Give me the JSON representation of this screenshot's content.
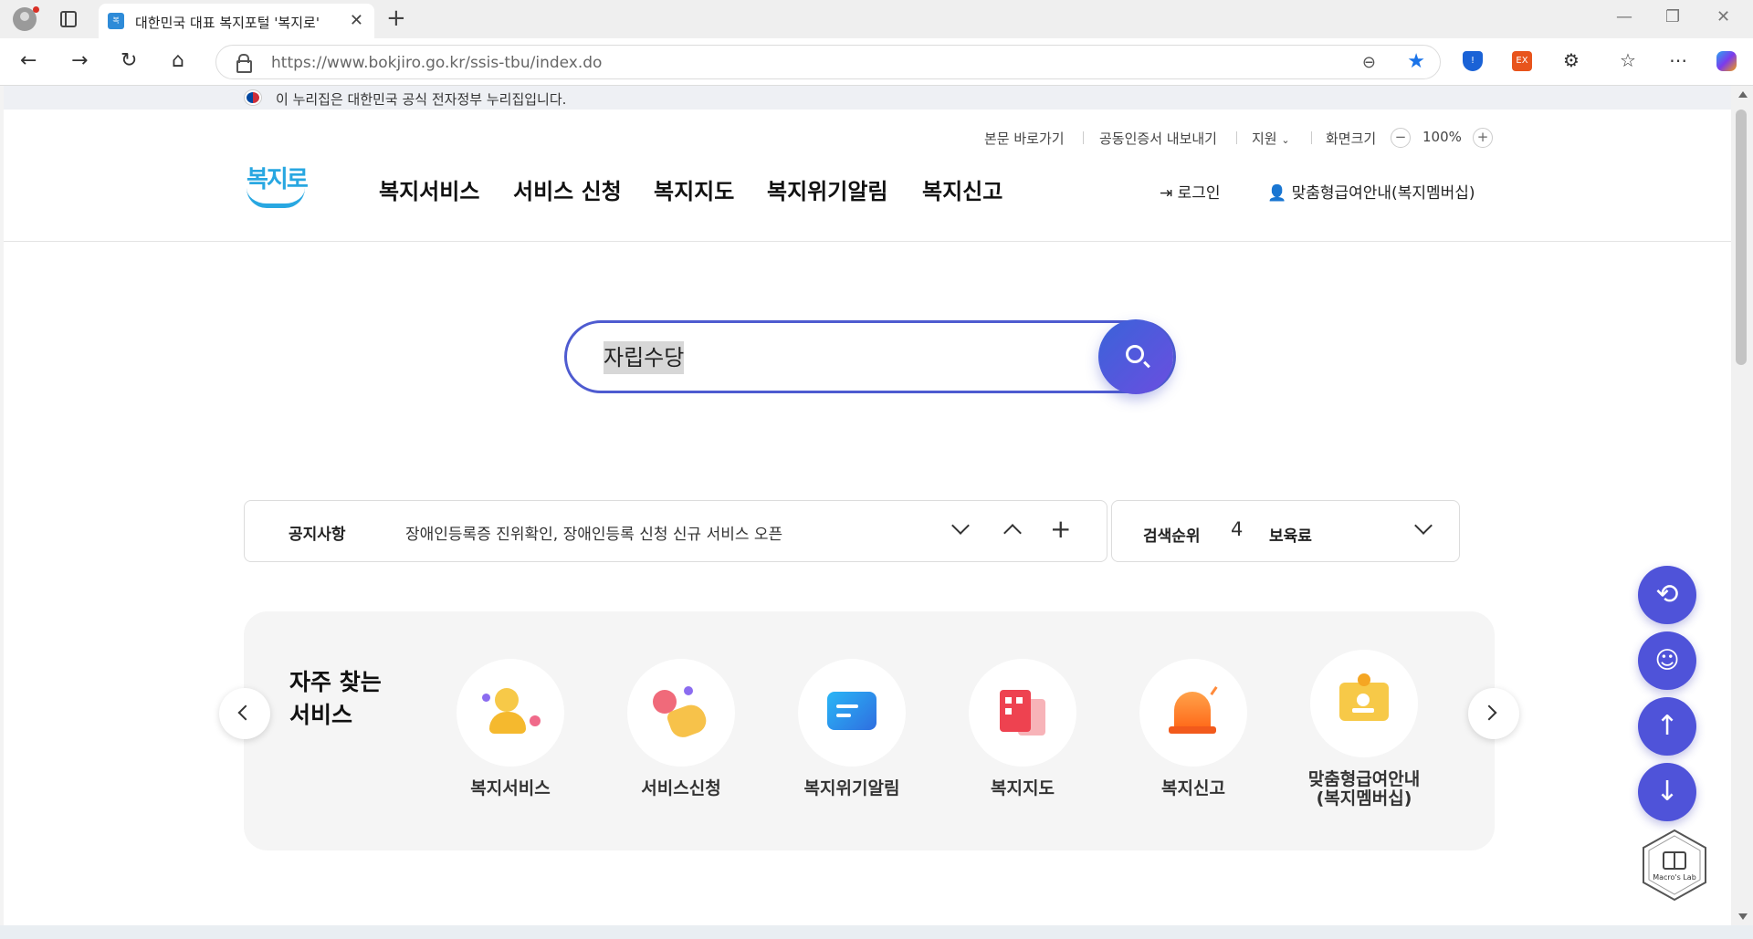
{
  "browser": {
    "tab_title": "대한민국 대표 복지포털 '복지로'",
    "url": "https://www.bokjiro.go.kr/ssis-tbu/index.do",
    "extension_ex_label": "EX"
  },
  "gov_banner": {
    "text": "이 누리집은 대한민국 공식 전자정부 누리집입니다."
  },
  "utility": {
    "skip_to_content": "본문 바로가기",
    "export_cert": "공동인증서 내보내기",
    "support": "지원",
    "screen_size": "화면크기",
    "zoom_level": "100%",
    "zoom_out": "−",
    "zoom_in": "+"
  },
  "logo": {
    "text": "복지로"
  },
  "gnb": [
    {
      "label": "복지서비스"
    },
    {
      "label": "서비스 신청"
    },
    {
      "label": "복지지도"
    },
    {
      "label": "복지위기알림"
    },
    {
      "label": "복지신고"
    }
  ],
  "header_actions": {
    "login": "로그인",
    "membership": "맞춤형급여안내(복지멤버십)"
  },
  "search": {
    "value": "자립수당"
  },
  "notice": {
    "label": "공지사항",
    "text": "장애인등록증 진위확인, 장애인등록 신청 신규 서비스 오픈"
  },
  "search_rank": {
    "label": "검색순위",
    "rank": "4",
    "keyword": "보육료"
  },
  "frequent": {
    "title": "자주 찾는 서비스",
    "items": [
      {
        "label": "복지서비스",
        "icon": "people-icon"
      },
      {
        "label": "서비스신청",
        "icon": "hand-tap-icon"
      },
      {
        "label": "복지위기알림",
        "icon": "chat-card-icon"
      },
      {
        "label": "복지지도",
        "icon": "map-building-icon"
      },
      {
        "label": "복지신고",
        "icon": "siren-icon"
      },
      {
        "label_line1": "맞춤형급여안내",
        "label_line2": "(복지멤버십)",
        "icon": "badge-icon"
      }
    ]
  },
  "floating": {
    "macro_label": "Macro's Lab"
  },
  "colors": {
    "accent": "#4f53d9",
    "logo": "#28a7e1",
    "search_border": "#4e5bd0"
  }
}
